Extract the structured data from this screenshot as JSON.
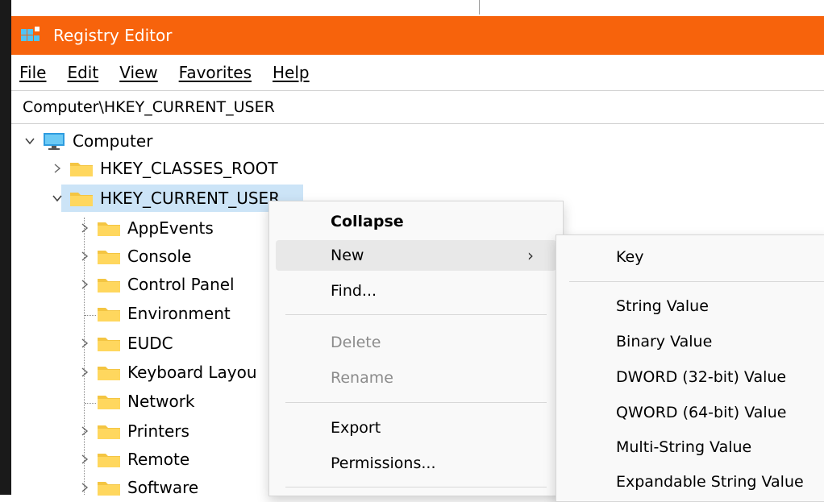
{
  "window": {
    "title": "Registry Editor",
    "accent": "#f7630c"
  },
  "menu": [
    "File",
    "Edit",
    "View",
    "Favorites",
    "Help"
  ],
  "address": "Computer\\HKEY_CURRENT_USER",
  "tree": {
    "root": "Computer",
    "hives": [
      "HKEY_CLASSES_ROOT",
      "HKEY_CURRENT_USER"
    ],
    "children": [
      "AppEvents",
      "Console",
      "Control Panel",
      "Environment",
      "EUDC",
      "Keyboard Layou",
      "Network",
      "Printers",
      "Remote",
      "Software"
    ]
  },
  "context_menu": {
    "items": [
      "Collapse",
      "New",
      "Find...",
      "Delete",
      "Rename",
      "Export",
      "Permissions..."
    ],
    "new_arrow": "›"
  },
  "submenu": {
    "items": [
      "Key",
      "String Value",
      "Binary Value",
      "DWORD (32-bit) Value",
      "QWORD (64-bit) Value",
      "Multi-String Value",
      "Expandable String Value"
    ]
  },
  "icons": {
    "app": "registry-editor-icon",
    "computer": "computer-monitor-icon",
    "folder": "folder-icon",
    "expand": "chevron-right-icon",
    "collapse": "chevron-down-icon"
  }
}
